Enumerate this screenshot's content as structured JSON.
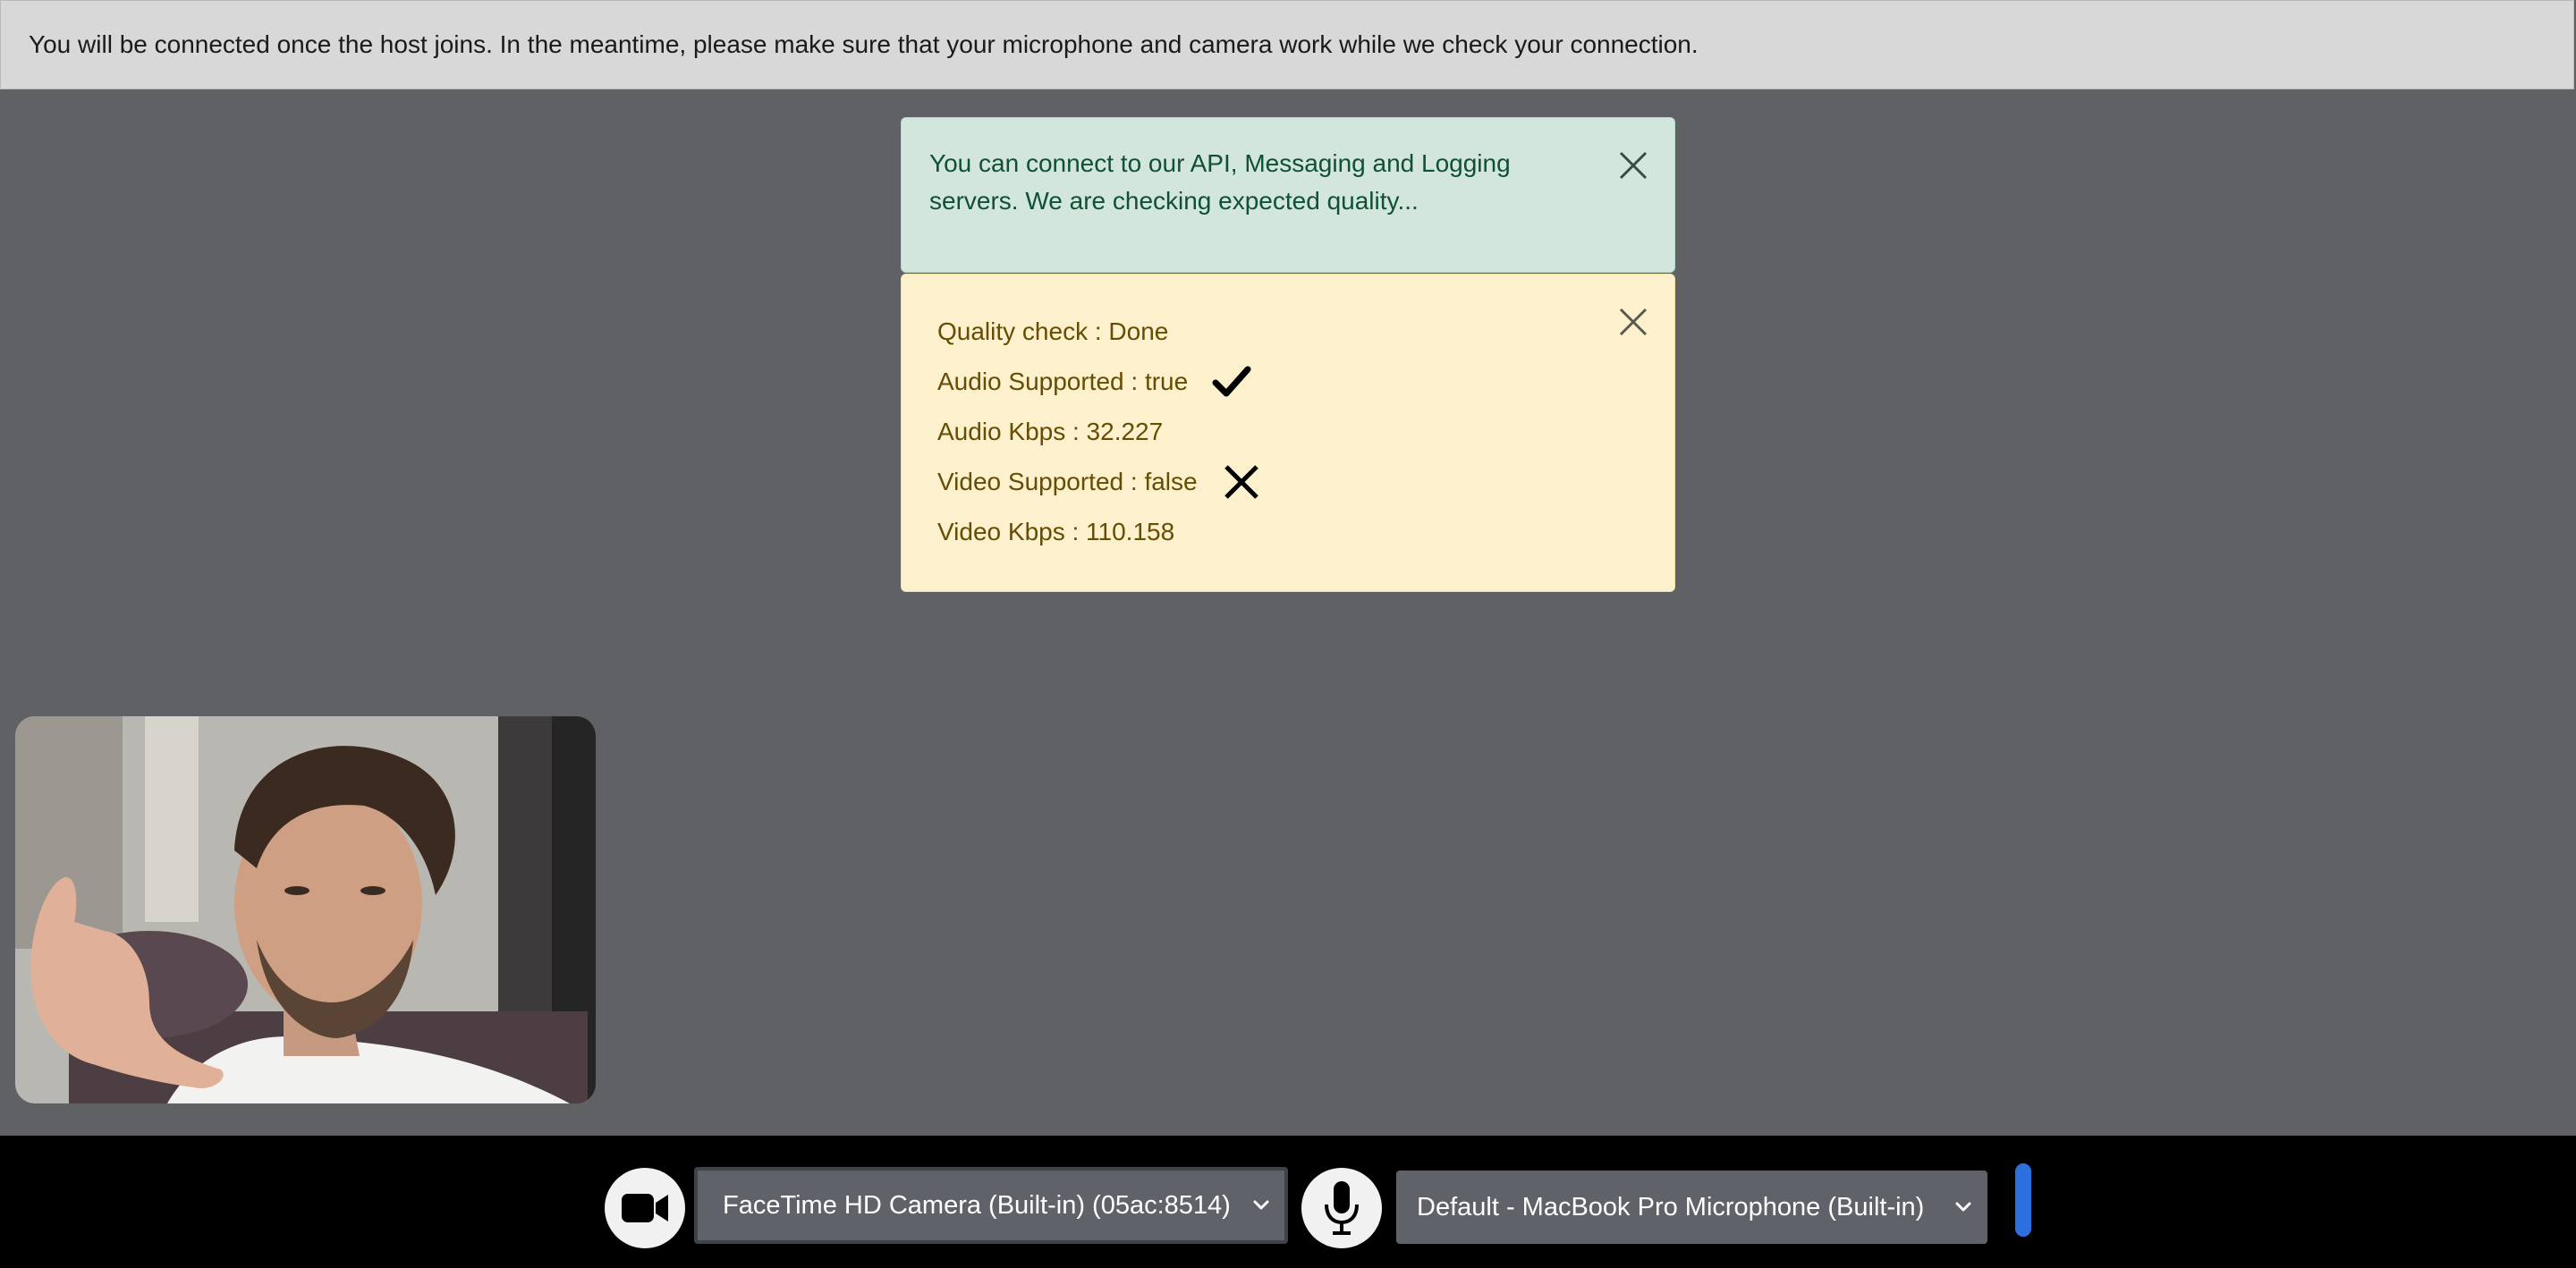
{
  "banner": {
    "text": "You will be connected once the host joins. In the meantime, please make sure that your microphone and camera work while we check your connection."
  },
  "connection_alert": {
    "text": "You can connect to our API, Messaging and Logging servers. We are checking expected quality...",
    "close_icon": "close-icon"
  },
  "quality_alert": {
    "close_icon": "close-icon",
    "rows": [
      {
        "text": "Quality check : Done",
        "icon": ""
      },
      {
        "text": "Audio Supported : true",
        "icon": "checkmark-icon"
      },
      {
        "text": "Audio Kbps : 32.227",
        "icon": ""
      },
      {
        "text": "Video Supported : false",
        "icon": "cross-icon"
      },
      {
        "text": "Video Kbps : 110.158",
        "icon": ""
      }
    ]
  },
  "controls": {
    "camera_icon": "video-camera-icon",
    "camera_select_value": "FaceTime HD Camera (Built-in) (05ac:8514)",
    "mic_icon": "microphone-icon",
    "mic_select_value": "Default - MacBook Pro Microphone (Built-in)",
    "level_meter_color": "#2e6fe0"
  },
  "colors": {
    "banner_bg": "#d8d8d8",
    "stage_bg": "#5f6164",
    "success_bg": "#d2e6de",
    "success_text": "#0f5132",
    "warning_bg": "#fcf0cd",
    "warning_text": "#664d03",
    "bottom_bar_bg": "#000000"
  }
}
